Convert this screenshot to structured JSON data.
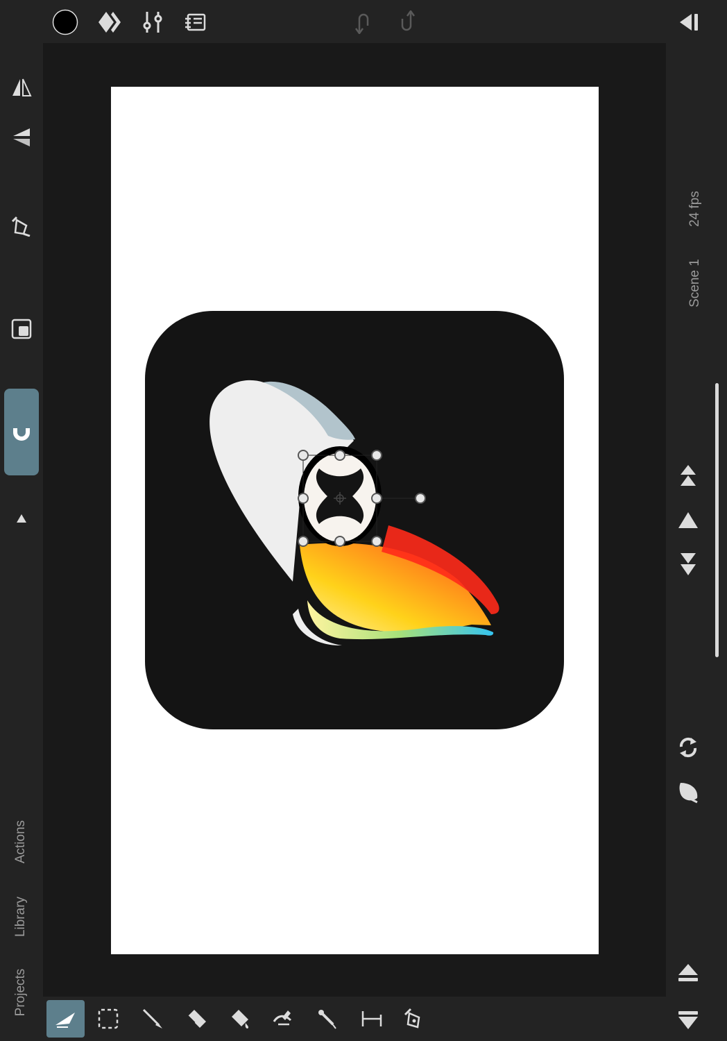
{
  "side_panels": {
    "projects_label": "Projects",
    "library_label": "Library",
    "actions_label": "Actions"
  },
  "scene": {
    "name": "Scene 1",
    "fps": "24 fps"
  },
  "colors": {
    "accent": "#5d7f8c",
    "stroke_color": "#000000",
    "artboard": "#ffffff",
    "app_tile": "#141414"
  },
  "toolbar_top": {
    "icons": [
      "color-swatch-icon",
      "style-icon",
      "adjustments-icon",
      "inspector-icon",
      "undo-icon",
      "redo-icon",
      "collapse-panel-icon"
    ]
  },
  "toolbar_left": {
    "icons": [
      "flip-horizontal-icon",
      "flip-vertical-icon",
      "pen-plus-icon",
      "arrange-icon",
      "magnet-icon",
      "expand-arrow-icon"
    ]
  },
  "toolbar_right": {
    "icons": [
      "bring-to-front-icon",
      "bring-forward-icon",
      "send-to-back-icon",
      "loop-icon",
      "onion-skin-icon",
      "previous-frame-icon",
      "next-frame-icon"
    ]
  },
  "toolbar_bottom": {
    "active_tool": "selection-tool",
    "tools": [
      "selection-tool",
      "marquee-tool",
      "brush-tool",
      "eraser-tool",
      "fill-tool",
      "bend-tool",
      "eyedropper-tool",
      "measure-tool",
      "pen-tool"
    ]
  }
}
